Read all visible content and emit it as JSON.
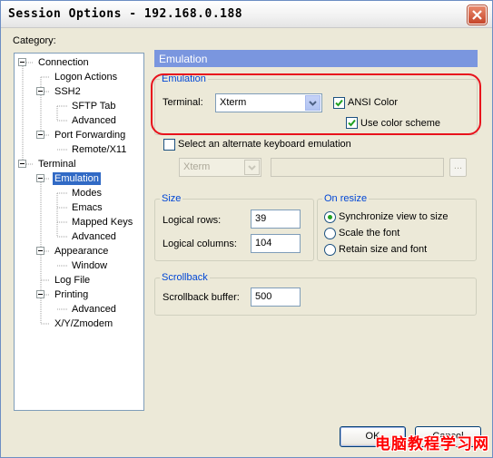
{
  "window": {
    "title": "Session Options - 192.168.0.188"
  },
  "category": {
    "label": "Category:",
    "tree": [
      {
        "id": "connection",
        "label": "Connection",
        "level": 0,
        "expanded": true
      },
      {
        "id": "logon-actions",
        "label": "Logon Actions",
        "level": 1
      },
      {
        "id": "ssh2",
        "label": "SSH2",
        "level": 1,
        "expanded": true
      },
      {
        "id": "sftp-tab",
        "label": "SFTP Tab",
        "level": 2
      },
      {
        "id": "ssh2-advanced",
        "label": "Advanced",
        "level": 2
      },
      {
        "id": "port-forwarding",
        "label": "Port Forwarding",
        "level": 1,
        "expanded": true
      },
      {
        "id": "remote-x11",
        "label": "Remote/X11",
        "level": 2
      },
      {
        "id": "terminal",
        "label": "Terminal",
        "level": 0,
        "expanded": true
      },
      {
        "id": "emulation",
        "label": "Emulation",
        "level": 1,
        "expanded": true,
        "selected": true
      },
      {
        "id": "modes",
        "label": "Modes",
        "level": 2
      },
      {
        "id": "emacs",
        "label": "Emacs",
        "level": 2
      },
      {
        "id": "mapped-keys",
        "label": "Mapped Keys",
        "level": 2
      },
      {
        "id": "emulation-advanced",
        "label": "Advanced",
        "level": 2
      },
      {
        "id": "appearance",
        "label": "Appearance",
        "level": 1,
        "expanded": true
      },
      {
        "id": "window",
        "label": "Window",
        "level": 2
      },
      {
        "id": "log-file",
        "label": "Log File",
        "level": 1
      },
      {
        "id": "printing",
        "label": "Printing",
        "level": 1,
        "expanded": true
      },
      {
        "id": "printing-advanced",
        "label": "Advanced",
        "level": 2
      },
      {
        "id": "xyzmodem",
        "label": "X/Y/Zmodem",
        "level": 1
      }
    ]
  },
  "panel": {
    "header": "Emulation",
    "emulation_group": {
      "legend": "Emulation",
      "terminal_label": "Terminal:",
      "terminal_value": "Xterm",
      "ansi_color_label": "ANSI Color",
      "ansi_color_checked": true,
      "use_color_scheme_label": "Use color scheme",
      "use_color_scheme_checked": true
    },
    "alternate": {
      "label": "Select an alternate keyboard emulation",
      "checked": false,
      "combo_value": "Xterm",
      "text_value": "",
      "browse_label": "..."
    },
    "size_group": {
      "legend": "Size",
      "rows_label": "Logical rows:",
      "rows_value": "39",
      "columns_label": "Logical columns:",
      "columns_value": "104"
    },
    "resize_group": {
      "legend": "On resize",
      "options": [
        "Synchronize view to size",
        "Scale the font",
        "Retain size and font"
      ],
      "selected_index": 0
    },
    "scrollback_group": {
      "legend": "Scrollback",
      "buffer_label": "Scrollback buffer:",
      "buffer_value": "500"
    }
  },
  "buttons": {
    "ok": "OK",
    "cancel": "Cancel"
  },
  "watermark": "电脑教程学习网",
  "colors": {
    "highlight": "#e8121c",
    "header_bg": "#7a96df",
    "selection": "#316ac5",
    "legend": "#0046d5"
  }
}
